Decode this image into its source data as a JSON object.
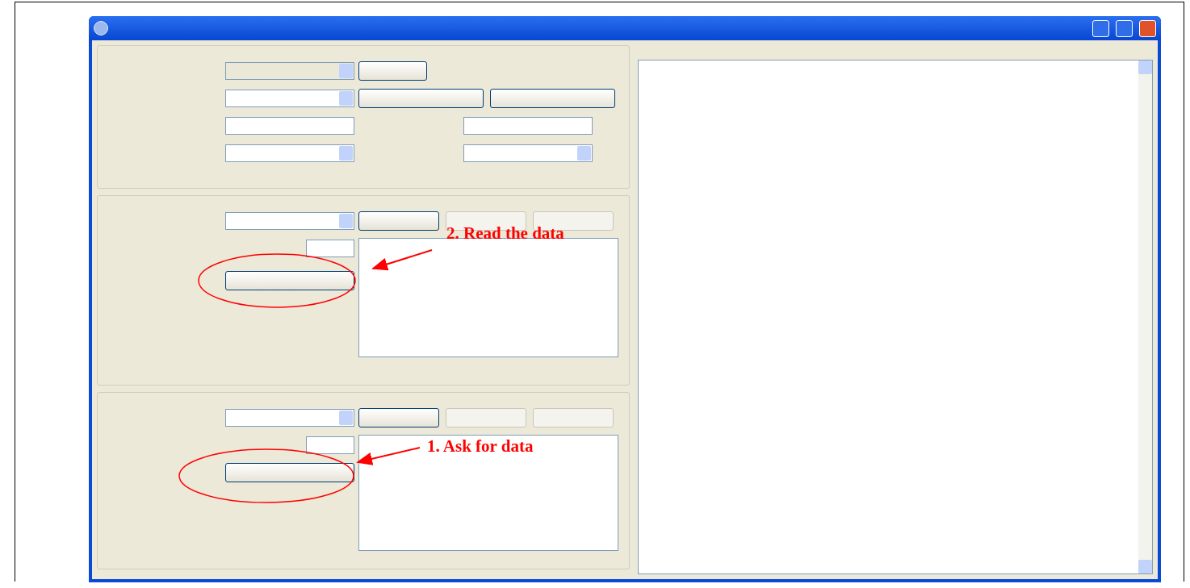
{
  "annotations": [
    {
      "kind": "callout",
      "label": "2. Read the data"
    },
    {
      "kind": "callout",
      "label": "1. Ask for data"
    }
  ]
}
